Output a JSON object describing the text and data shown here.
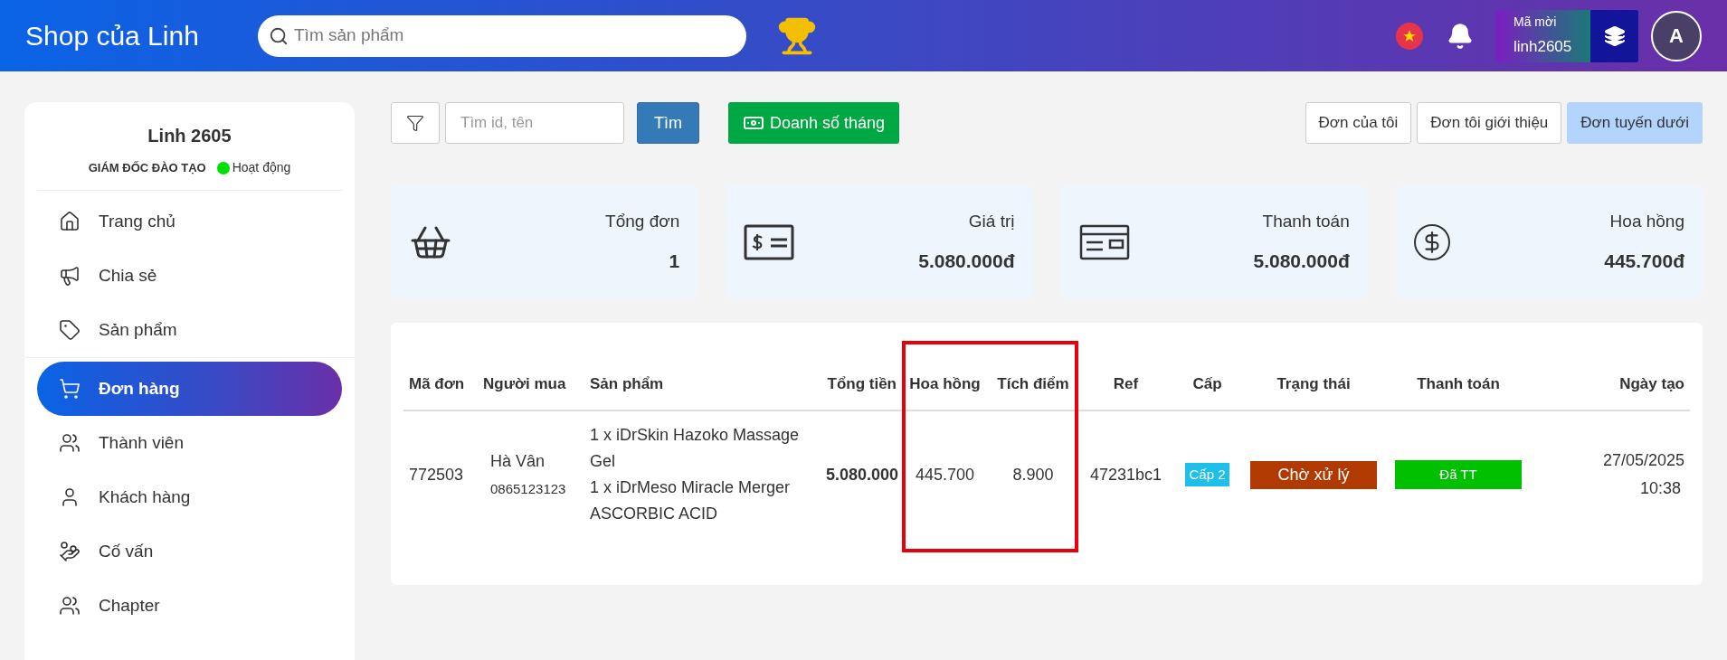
{
  "header": {
    "title": "Shop của Linh",
    "search": {
      "placeholder": "Tìm sản phẩm"
    },
    "invite": {
      "label": "Mã mời",
      "code": "linh2605"
    },
    "avatar": "A"
  },
  "profile": {
    "name": "Linh 2605",
    "role": "GIÁM ĐỐC ĐÀO TẠO",
    "status": "Hoạt động",
    "online": true
  },
  "sidebar": {
    "items": [
      {
        "label": "Trang chủ",
        "selected": false
      },
      {
        "label": "Chia sẻ",
        "selected": false
      },
      {
        "label": "Sản phẩm",
        "selected": false
      },
      {
        "label": "Đơn hàng",
        "selected": true
      },
      {
        "label": "Thành viên",
        "selected": false
      },
      {
        "label": "Khách hàng",
        "selected": false
      },
      {
        "label": "Cố vấn",
        "selected": false
      },
      {
        "label": "Chapter",
        "selected": false
      }
    ]
  },
  "toolbar": {
    "search": {
      "placeholder": "Tìm id, tên"
    },
    "search_button": "Tìm",
    "sales_button": "Doanh số tháng",
    "tabs": [
      {
        "label": "Đơn của tôi",
        "selected": false
      },
      {
        "label": "Đơn tôi giới thiệu",
        "selected": false
      },
      {
        "label": "Đơn tuyến dưới",
        "selected": true
      }
    ]
  },
  "stats": [
    {
      "label": "Tổng đơn",
      "value": "1"
    },
    {
      "label": "Giá trị",
      "value": "5.080.000đ"
    },
    {
      "label": "Thanh toán",
      "value": "5.080.000đ"
    },
    {
      "label": "Hoa hồng",
      "value": "445.700đ"
    }
  ],
  "table": {
    "columns": [
      {
        "label": "Mã đơn",
        "highlighted": false
      },
      {
        "label": "Người mua",
        "highlighted": false
      },
      {
        "label": "Sản phẩm",
        "highlighted": false
      },
      {
        "label": "Tổng tiền",
        "highlighted": false
      },
      {
        "label": "Hoa hồng",
        "highlighted": true
      },
      {
        "label": "Tích điểm",
        "highlighted": true
      },
      {
        "label": "Ref",
        "highlighted": false
      },
      {
        "label": "Cấp",
        "highlighted": false
      },
      {
        "label": "Trạng thái",
        "highlighted": false
      },
      {
        "label": "Thanh toán",
        "highlighted": false
      },
      {
        "label": "Ngày tạo",
        "highlighted": false
      }
    ],
    "rows": [
      {
        "id": "772503",
        "buyer": "Hà Vân",
        "phone": "0865123123",
        "products": [
          "1 x iDrSkin Hazoko Massage Gel",
          "1 x iDrMeso Miracle Merger ASCORBIC ACID"
        ],
        "total": "5.080.000",
        "commission": "445.700",
        "points": "8.900",
        "ref": "47231bc1",
        "level": {
          "label": "Cấp 2",
          "color": "#1ebfe8"
        },
        "status": {
          "label": "Chờ xử lý",
          "color": "#b03a02"
        },
        "payment": {
          "label": "Đã TT",
          "color": "#00c000"
        },
        "date": "27/05/2025",
        "time": "10:38"
      }
    ]
  }
}
